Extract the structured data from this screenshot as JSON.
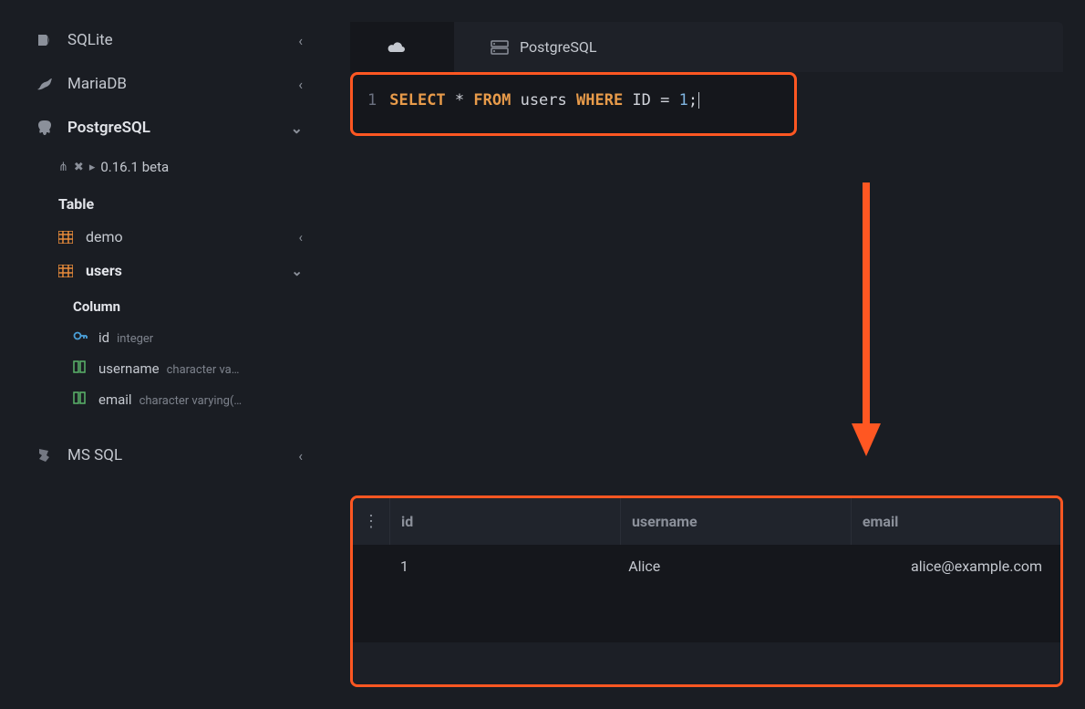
{
  "sidebar": {
    "databases": [
      {
        "name": "SQLite",
        "icon": "sqlite-icon",
        "expanded": false,
        "active": false
      },
      {
        "name": "MariaDB",
        "icon": "mariadb-icon",
        "expanded": false,
        "active": false
      },
      {
        "name": "PostgreSQL",
        "icon": "postgresql-icon",
        "expanded": true,
        "active": true
      },
      {
        "name": "MS SQL",
        "icon": "mssql-icon",
        "expanded": false,
        "active": false
      }
    ],
    "version": "0.16.1 beta",
    "table_section_label": "Table",
    "tables": [
      {
        "name": "demo",
        "expanded": false,
        "active": false
      },
      {
        "name": "users",
        "expanded": true,
        "active": true
      }
    ],
    "column_section_label": "Column",
    "columns": [
      {
        "name": "id",
        "type": "integer",
        "icon": "key"
      },
      {
        "name": "username",
        "type": "character va…",
        "icon": "col"
      },
      {
        "name": "email",
        "type": "character varying(…",
        "icon": "col"
      }
    ]
  },
  "tabs": [
    {
      "label": "",
      "icon": "cloud-icon",
      "active": true
    },
    {
      "label": "PostgreSQL",
      "icon": "server-icon",
      "active": false
    }
  ],
  "editor": {
    "line_number": "1",
    "tokens": [
      {
        "t": "SELECT",
        "c": "kw"
      },
      {
        "t": " * ",
        "c": "op"
      },
      {
        "t": "FROM",
        "c": "kw"
      },
      {
        "t": " users ",
        "c": "ident"
      },
      {
        "t": "WHERE",
        "c": "kw"
      },
      {
        "t": " ID ",
        "c": "ident"
      },
      {
        "t": "=",
        "c": "op"
      },
      {
        "t": " ",
        "c": "op"
      },
      {
        "t": "1",
        "c": "num"
      },
      {
        "t": ";",
        "c": "op"
      }
    ]
  },
  "results": {
    "columns": [
      "id",
      "username",
      "email"
    ],
    "rows": [
      {
        "id": "1",
        "username": "Alice",
        "email": "alice@example.com"
      }
    ]
  },
  "colors": {
    "highlight": "#ff5722",
    "keyword": "#e89b4a",
    "number": "#7fb4e0"
  }
}
